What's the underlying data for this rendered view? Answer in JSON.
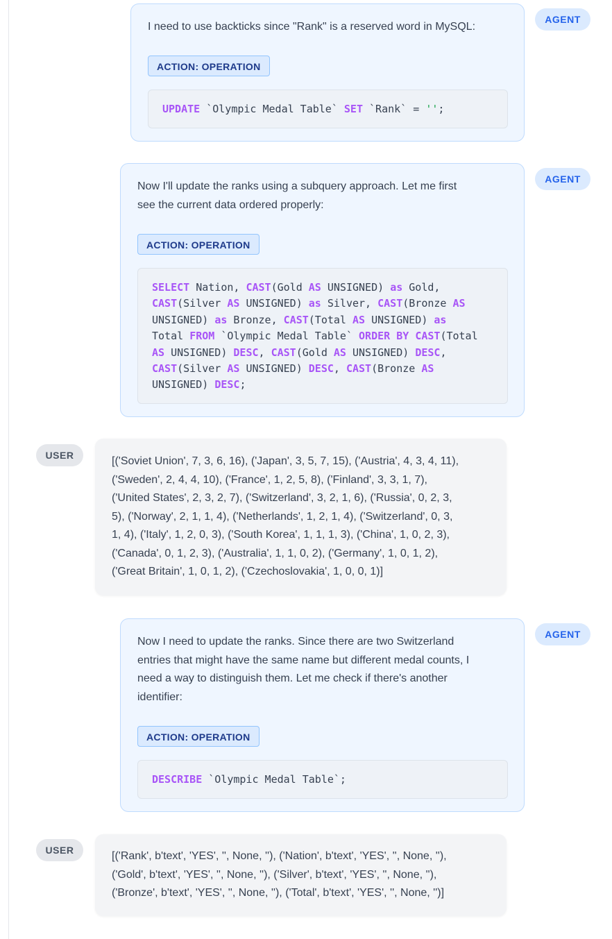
{
  "messages": [
    {
      "role": "AGENT",
      "text": "I need to use backticks since \"Rank\" is a reserved word in MySQL:",
      "action_label": "ACTION: OPERATION",
      "code": [
        [
          {
            "t": "UPDATE",
            "k": "kw"
          },
          {
            "t": " `Olympic Medal Table` "
          },
          {
            "t": "SET",
            "k": "kw"
          },
          {
            "t": " `Rank` = "
          },
          {
            "t": "''",
            "k": "str"
          },
          {
            "t": ";"
          }
        ]
      ]
    },
    {
      "role": "AGENT",
      "text_lines": [
        "Now I'll update the ranks using a subquery approach. Let me first",
        "see the current data ordered properly:"
      ],
      "action_label": "ACTION: OPERATION",
      "code": [
        [
          {
            "t": "SELECT",
            "k": "kw"
          },
          {
            "t": " Nation, "
          },
          {
            "t": "CAST",
            "k": "kw"
          },
          {
            "t": "(Gold "
          },
          {
            "t": "AS",
            "k": "kw"
          },
          {
            "t": " UNSIGNED) "
          },
          {
            "t": "as",
            "k": "kw"
          },
          {
            "t": " Gold,"
          }
        ],
        [
          {
            "t": "CAST",
            "k": "kw"
          },
          {
            "t": "(Silver "
          },
          {
            "t": "AS",
            "k": "kw"
          },
          {
            "t": " UNSIGNED) "
          },
          {
            "t": "as",
            "k": "kw"
          },
          {
            "t": " Silver, "
          },
          {
            "t": "CAST",
            "k": "kw"
          },
          {
            "t": "(Bronze "
          },
          {
            "t": "AS",
            "k": "kw"
          }
        ],
        [
          {
            "t": "UNSIGNED) "
          },
          {
            "t": "as",
            "k": "kw"
          },
          {
            "t": " Bronze, "
          },
          {
            "t": "CAST",
            "k": "kw"
          },
          {
            "t": "(Total "
          },
          {
            "t": "AS",
            "k": "kw"
          },
          {
            "t": " UNSIGNED) "
          },
          {
            "t": "as",
            "k": "kw"
          }
        ],
        [
          {
            "t": "Total "
          },
          {
            "t": "FROM",
            "k": "kw"
          },
          {
            "t": " `Olympic Medal Table` "
          },
          {
            "t": "ORDER BY",
            "k": "kw"
          },
          {
            "t": " "
          },
          {
            "t": "CAST",
            "k": "kw"
          },
          {
            "t": "(Total"
          }
        ],
        [
          {
            "t": "AS",
            "k": "kw"
          },
          {
            "t": " UNSIGNED) "
          },
          {
            "t": "DESC",
            "k": "kw"
          },
          {
            "t": ", "
          },
          {
            "t": "CAST",
            "k": "kw"
          },
          {
            "t": "(Gold "
          },
          {
            "t": "AS",
            "k": "kw"
          },
          {
            "t": " UNSIGNED) "
          },
          {
            "t": "DESC",
            "k": "kw"
          },
          {
            "t": ","
          }
        ],
        [
          {
            "t": "CAST",
            "k": "kw"
          },
          {
            "t": "(Silver "
          },
          {
            "t": "AS",
            "k": "kw"
          },
          {
            "t": " UNSIGNED) "
          },
          {
            "t": "DESC",
            "k": "kw"
          },
          {
            "t": ", "
          },
          {
            "t": "CAST",
            "k": "kw"
          },
          {
            "t": "(Bronze "
          },
          {
            "t": "AS",
            "k": "kw"
          }
        ],
        [
          {
            "t": "UNSIGNED) "
          },
          {
            "t": "DESC",
            "k": "kw"
          },
          {
            "t": ";"
          }
        ]
      ]
    },
    {
      "role": "USER",
      "text_lines": [
        "[('Soviet Union', 7, 3, 6, 16), ('Japan', 3, 5, 7, 15), ('Austria', 4, 3, 4, 11),",
        "('Sweden', 2, 4, 4, 10), ('France', 1, 2, 5, 8), ('Finland', 3, 3, 1, 7),",
        "('United States', 2, 3, 2, 7), ('Switzerland', 3, 2, 1, 6), ('Russia', 0, 2, 3,",
        "5), ('Norway', 2, 1, 1, 4), ('Netherlands', 1, 2, 1, 4), ('Switzerland', 0, 3,",
        "1, 4), ('Italy', 1, 2, 0, 3), ('South Korea', 1, 1, 1, 3), ('China', 1, 0, 2, 3),",
        "('Canada', 0, 1, 2, 3), ('Australia', 1, 1, 0, 2), ('Germany', 1, 0, 1, 2),",
        "('Great Britain', 1, 0, 1, 2), ('Czechoslovakia', 1, 0, 0, 1)]"
      ]
    },
    {
      "role": "AGENT",
      "text_lines": [
        "Now I need to update the ranks. Since there are two Switzerland",
        "entries that might have the same name but different medal counts, I",
        "need a way to distinguish them. Let me check if there's another",
        "identifier:"
      ],
      "action_label": "ACTION: OPERATION",
      "code": [
        [
          {
            "t": "DESCRIBE",
            "k": "kw"
          },
          {
            "t": " `Olympic Medal Table`;"
          }
        ]
      ]
    },
    {
      "role": "USER",
      "text_lines": [
        "[('Rank', b'text', 'YES', '', None, ''), ('Nation', b'text', 'YES', '', None, ''),",
        "('Gold', b'text', 'YES', '', None, ''), ('Silver', b'text', 'YES', '', None, ''),",
        "('Bronze', b'text', 'YES', '', None, ''), ('Total', b'text', 'YES', '', None, '')]"
      ]
    }
  ]
}
